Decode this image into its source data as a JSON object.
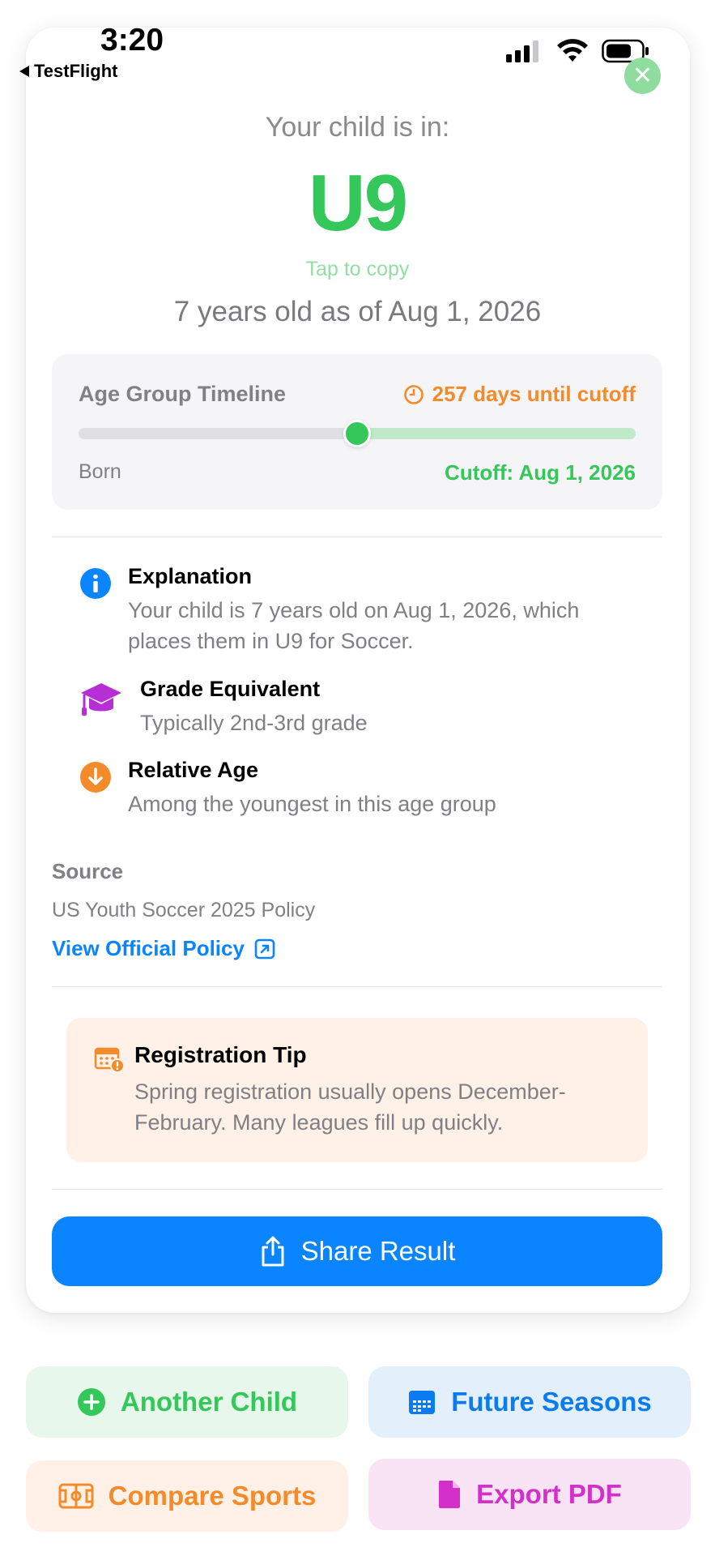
{
  "status_bar": {
    "time": "3:20",
    "back_app": "TestFlight"
  },
  "result": {
    "label": "Your child is in:",
    "group": "U9",
    "copy_hint": "Tap to copy",
    "age_line": "7 years old as of Aug 1, 2026"
  },
  "timeline": {
    "title": "Age Group Timeline",
    "countdown": "257 days until cutoff",
    "start_label": "Born",
    "end_label": "Cutoff: Aug 1, 2026",
    "progress_fraction": 0.5
  },
  "info": [
    {
      "icon": "info-icon",
      "title": "Explanation",
      "body": "Your child is 7 years old on Aug 1, 2026, which places them in U9 for Soccer."
    },
    {
      "icon": "graduation-cap-icon",
      "title": "Grade Equivalent",
      "body": "Typically 2nd-3rd grade"
    },
    {
      "icon": "arrow-down-circle-icon",
      "title": "Relative Age",
      "body": "Among the youngest in this age group"
    }
  ],
  "source": {
    "heading": "Source",
    "text": "US Youth Soccer 2025 Policy",
    "link": "View Official Policy"
  },
  "tip": {
    "title": "Registration Tip",
    "body": "Spring registration usually opens December-February. Many leagues fill up quickly."
  },
  "share_button": "Share Result",
  "actions": {
    "another_child": "Another Child",
    "future_seasons": "Future Seasons",
    "compare_sports": "Compare Sports",
    "export_pdf": "Export PDF"
  },
  "colors": {
    "green": "#34c759",
    "blue": "#0a84ff",
    "orange": "#f48b2a",
    "purple": "#b72ed6",
    "magenta": "#d230c8"
  }
}
